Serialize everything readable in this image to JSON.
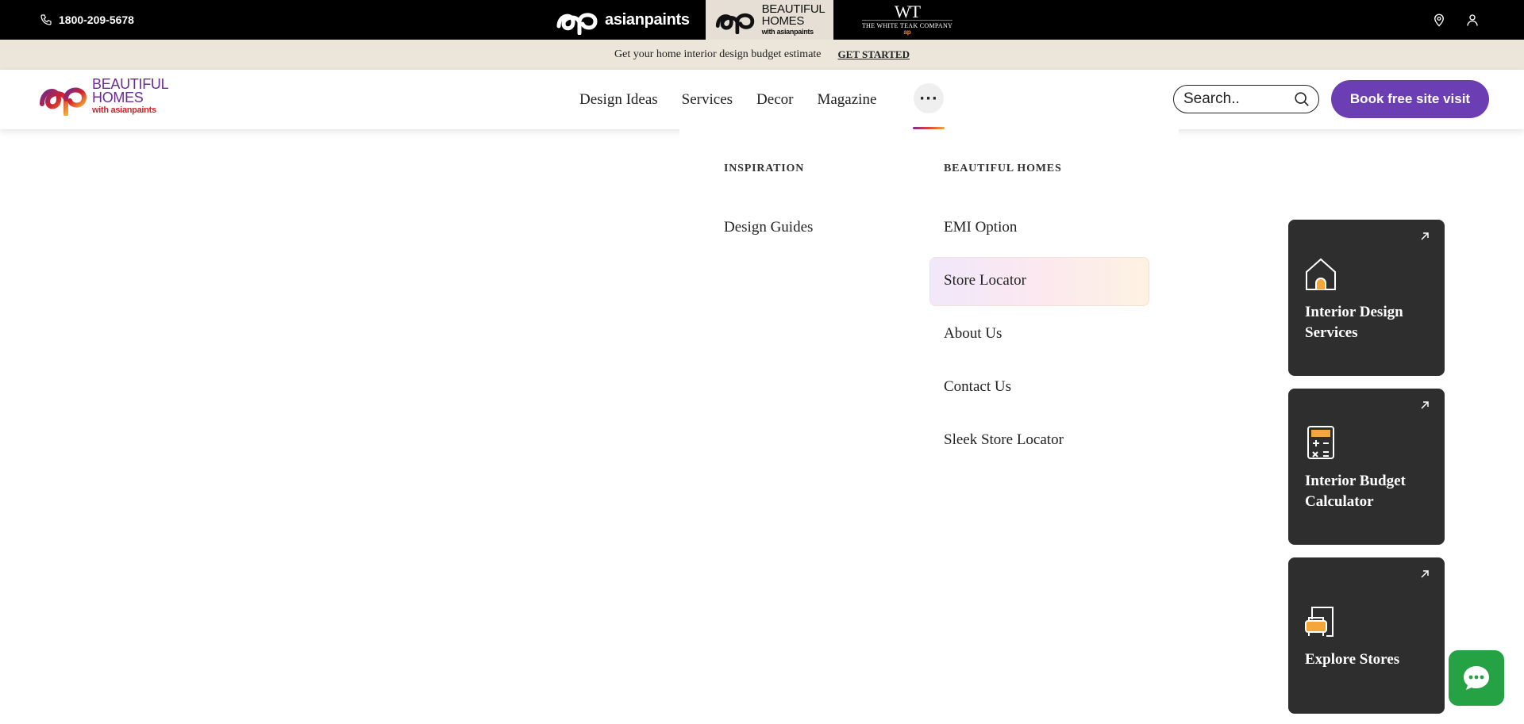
{
  "topbar": {
    "phone": "1800-209-5678",
    "brands": {
      "asianpaints": "asianpaints",
      "beautiful_homes_line1": "BEAUTIFUL",
      "beautiful_homes_line2": "HOMES",
      "beautiful_homes_sub": "with asianpaints",
      "white_teak_mark": "WT",
      "white_teak_name": "THE WHITE TEAK COMPANY",
      "white_teak_sub": "ap"
    },
    "icons": [
      "location-pin-icon",
      "user-icon"
    ]
  },
  "promo": {
    "text": "Get your home interior design budget estimate",
    "cta": "GET STARTED"
  },
  "header": {
    "logo_line1": "BEAUTIFUL",
    "logo_line2": "HOMES",
    "logo_sub": "with asianpaints",
    "nav": [
      "Design Ideas",
      "Services",
      "Decor",
      "Magazine"
    ],
    "more_label": "···",
    "search_placeholder": "Search..",
    "book_label": "Book free site visit",
    "colors": {
      "book_button": "#6b3fb3",
      "logo_purple": "#6b2c91",
      "logo_red": "#d3212c"
    }
  },
  "dropdown": {
    "columns": [
      {
        "heading": "INSPIRATION",
        "links": [
          "Design Guides"
        ]
      },
      {
        "heading": "BEAUTIFUL HOMES",
        "links": [
          "EMI Option",
          "Store Locator",
          "About Us",
          "Contact Us",
          "Sleek Store Locator"
        ]
      }
    ],
    "highlighted": "Store Locator"
  },
  "cards": [
    {
      "label": "Interior Design Services",
      "icon": "house-icon"
    },
    {
      "label": "Interior Budget Calculator",
      "icon": "calculator-icon"
    },
    {
      "label": "Explore Stores",
      "icon": "store-icon"
    }
  ],
  "chat": {
    "icon": "chat-bubble-icon",
    "color": "#25a244"
  }
}
